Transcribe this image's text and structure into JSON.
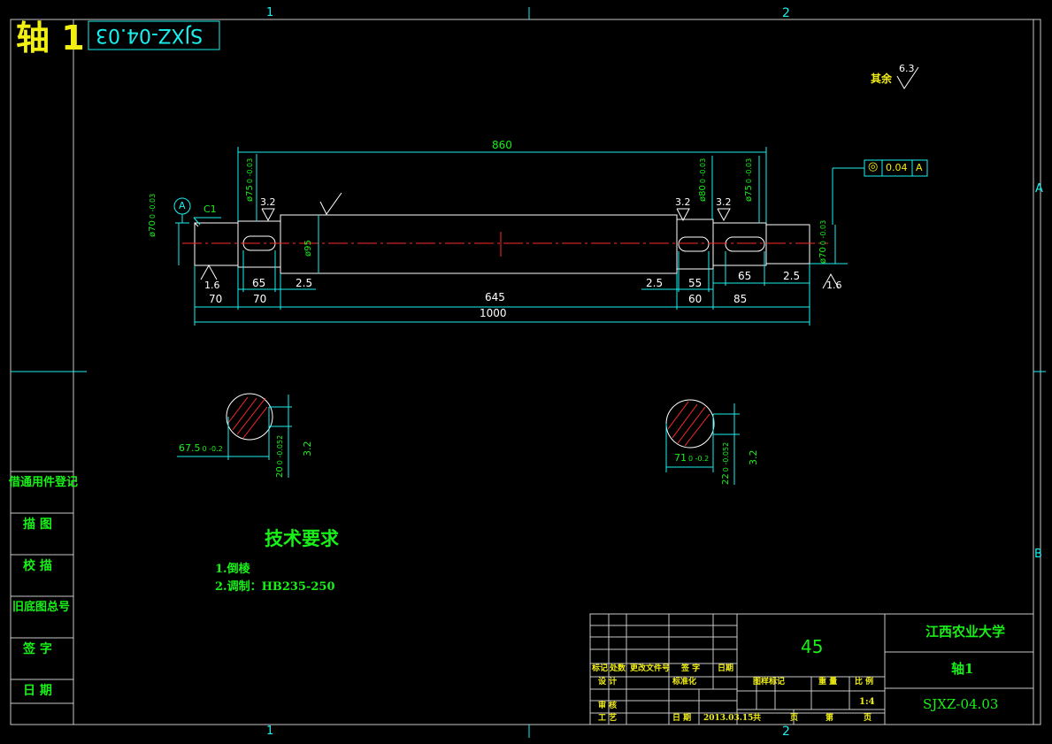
{
  "sheet": {
    "title_big": "轴 1",
    "drawing_code_flipped": "SJXZ-04.03",
    "zone_top": [
      "1",
      "2"
    ],
    "zone_bottom": [
      "1",
      "2"
    ],
    "zone_right": [
      "A",
      "B"
    ],
    "roughness_other_label": "其余",
    "roughness_other_value": "6.3"
  },
  "part_view": {
    "dims": {
      "overall_top": "860",
      "overall_bottom": "1000",
      "seg_left_70a": "70",
      "seg_left_70b": "70",
      "seg_mid_645": "645",
      "seg_right_60": "60",
      "seg_right_85": "85",
      "key_left_65": "65",
      "key_left_25": "2.5",
      "key_mid_25": "2.5",
      "key_right_55": "55",
      "key_right_65": "65",
      "key_right_25": "2.5"
    },
    "diameters": {
      "d70_left": "ø70",
      "d70_left_tol": "0 -0.03",
      "d75_left": "ø75",
      "d75_left_tol": "0 -0.03",
      "d95": "ø95",
      "d80": "ø80",
      "d80_tol": "0 -0.03",
      "d75_right": "ø75",
      "d75_right_tol": "0 -0.03",
      "d70_right": "ø70",
      "d70_right_tol": "0 -0.03"
    },
    "roughness": {
      "r32_left": "3.2",
      "r32_mid": "3.2",
      "r32_right": "3.2",
      "r16_left": "1.6",
      "r16_right": "1.6"
    },
    "chamfer": "C1",
    "datum": "A",
    "tolerance_frame": {
      "symbol": "◎",
      "value": "0.04",
      "datum": "A"
    }
  },
  "sections": {
    "left": {
      "dim_h": "67.5",
      "dim_h_tol": "0 -0.2",
      "dim_v": "20",
      "dim_v_tol": "0 -0.052",
      "roughness": "3.2"
    },
    "right": {
      "dim_h": "71",
      "dim_h_tol": "0 -0.2",
      "dim_v": "22",
      "dim_v_tol": "0 -0.052",
      "roughness": "3.2"
    }
  },
  "tech": {
    "heading": "技术要求",
    "items": [
      "1.倒棱",
      "2.调制：HB235-250"
    ]
  },
  "side_table": [
    "借通用件登记",
    "描 图",
    "校 描",
    "旧底图总号",
    "签 字",
    "日 期"
  ],
  "title_block": {
    "material": "45",
    "school": "江西农业大学",
    "part_name": "轴1",
    "code": "SJXZ-04.03",
    "hdr_mark": "标记",
    "hdr_count": "处数",
    "hdr_doc": "更改文件号",
    "hdr_sign": "签 字",
    "hdr_date": "日期",
    "design": "设 计",
    "standard": "标准化",
    "review": "审 核",
    "process": "工 艺",
    "date_label": "日 期",
    "date_value": "2013.03.15",
    "stage_mark": "图样标记",
    "weight": "重 量",
    "scale": "比 例",
    "scale_value": "1:4",
    "total": "共",
    "sheet_unit": "页",
    "page_no": "第",
    "page_unit": "页"
  }
}
